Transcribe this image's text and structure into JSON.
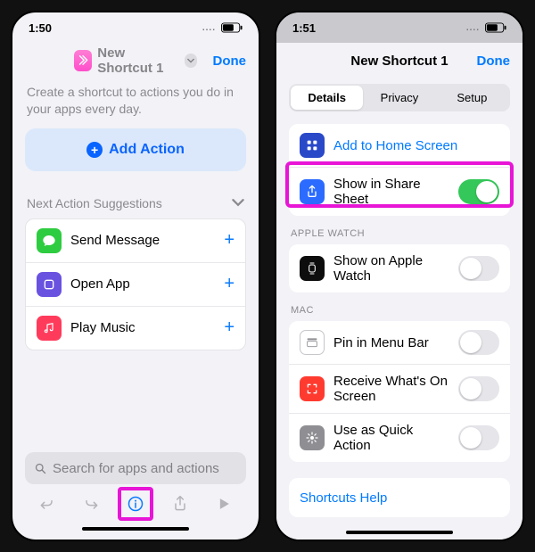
{
  "left": {
    "time": "1:50",
    "nav": {
      "title": "New Shortcut 1",
      "done": "Done"
    },
    "subtitle": "Create a shortcut to actions you do in your apps every day.",
    "addAction": "Add Action",
    "suggestHeader": "Next Action Suggestions",
    "suggestions": [
      {
        "label": "Send Message"
      },
      {
        "label": "Open App"
      },
      {
        "label": "Play Music"
      }
    ],
    "searchPlaceholder": "Search for apps and actions"
  },
  "right": {
    "time": "1:51",
    "nav": {
      "title": "New Shortcut 1",
      "done": "Done"
    },
    "tabs": {
      "details": "Details",
      "privacy": "Privacy",
      "setup": "Setup"
    },
    "main": {
      "addHome": "Add to Home Screen",
      "shareSheet": "Show in Share Sheet"
    },
    "appleWatchHeader": "APPLE WATCH",
    "appleWatch": {
      "show": "Show on Apple Watch"
    },
    "macHeader": "MAC",
    "mac": {
      "pin": "Pin in Menu Bar",
      "receive": "Receive What's On Screen",
      "quick": "Use as Quick Action"
    },
    "help": "Shortcuts Help"
  }
}
